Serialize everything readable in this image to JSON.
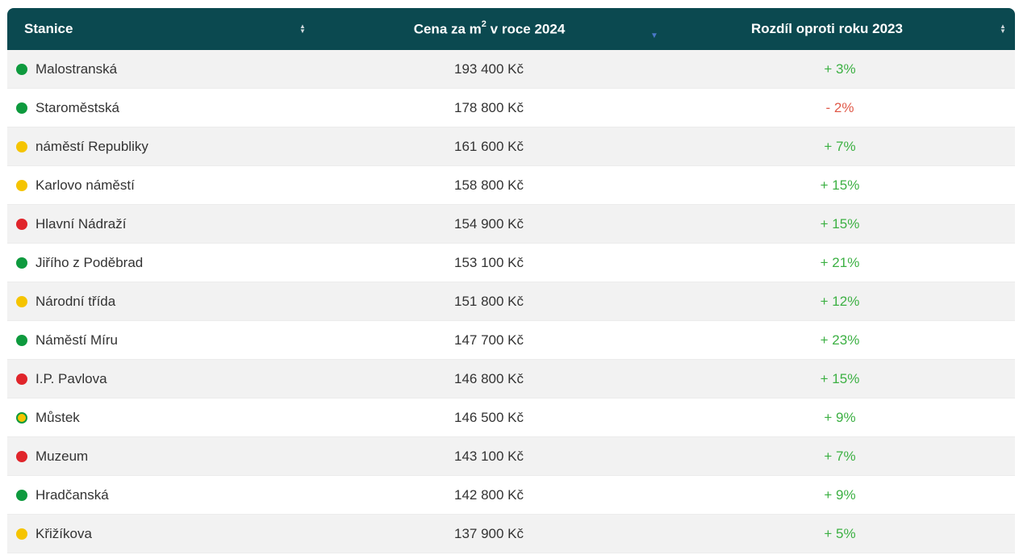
{
  "header": {
    "station": "Stanice",
    "price_prefix": "Cena za m",
    "price_sup": "2",
    "price_suffix": " v roce 2024",
    "diff": "Rozdíl oproti roku 2023"
  },
  "colors": {
    "header_bg": "#0b4950",
    "positive": "#3cb043",
    "negative": "#e05a4a",
    "green_line": "#0e9a3e",
    "yellow_line": "#f5c400",
    "red_line": "#e0252b"
  },
  "rows": [
    {
      "station": "Malostranská",
      "price": "193 400 Kč",
      "diff": "+ 3%",
      "dot": "#0e9a3e",
      "dot_ring": "",
      "trend": "up"
    },
    {
      "station": "Staroměstská",
      "price": "178 800 Kč",
      "diff": "- 2%",
      "dot": "#0e9a3e",
      "dot_ring": "",
      "trend": "down"
    },
    {
      "station": "náměstí Republiky",
      "price": "161 600 Kč",
      "diff": "+ 7%",
      "dot": "#f5c400",
      "dot_ring": "",
      "trend": "up"
    },
    {
      "station": "Karlovo náměstí",
      "price": "158 800 Kč",
      "diff": "+ 15%",
      "dot": "#f5c400",
      "dot_ring": "",
      "trend": "up"
    },
    {
      "station": "Hlavní Nádraží",
      "price": "154 900 Kč",
      "diff": "+ 15%",
      "dot": "#e0252b",
      "dot_ring": "",
      "trend": "up"
    },
    {
      "station": "Jiřího z Poděbrad",
      "price": "153 100 Kč",
      "diff": "+ 21%",
      "dot": "#0e9a3e",
      "dot_ring": "",
      "trend": "up"
    },
    {
      "station": "Národní třída",
      "price": "151 800 Kč",
      "diff": "+ 12%",
      "dot": "#f5c400",
      "dot_ring": "",
      "trend": "up"
    },
    {
      "station": "Náměstí Míru",
      "price": "147 700 Kč",
      "diff": "+ 23%",
      "dot": "#0e9a3e",
      "dot_ring": "",
      "trend": "up"
    },
    {
      "station": "I.P. Pavlova",
      "price": "146 800 Kč",
      "diff": "+ 15%",
      "dot": "#e0252b",
      "dot_ring": "",
      "trend": "up"
    },
    {
      "station": "Můstek",
      "price": "146 500 Kč",
      "diff": "+ 9%",
      "dot": "#f5c400",
      "dot_ring": "#0e9a3e",
      "trend": "up"
    },
    {
      "station": "Muzeum",
      "price": "143 100 Kč",
      "diff": "+ 7%",
      "dot": "#e0252b",
      "dot_ring": "",
      "trend": "up"
    },
    {
      "station": "Hradčanská",
      "price": "142 800 Kč",
      "diff": "+ 9%",
      "dot": "#0e9a3e",
      "dot_ring": "",
      "trend": "up"
    },
    {
      "station": "Křižíkova",
      "price": "137 900 Kč",
      "diff": "+ 5%",
      "dot": "#f5c400",
      "dot_ring": "",
      "trend": "up"
    }
  ]
}
